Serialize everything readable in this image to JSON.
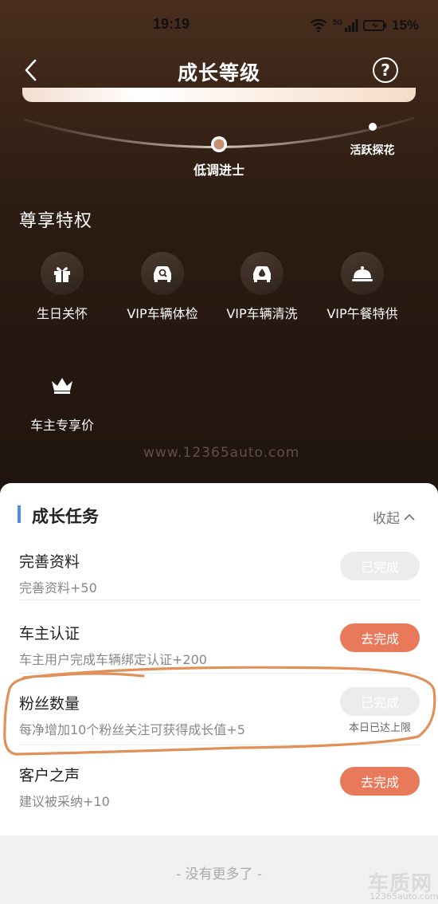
{
  "status_bar": {
    "time": "19:19",
    "network": "5G",
    "battery": "15%"
  },
  "nav": {
    "title": "成长等级"
  },
  "levels": {
    "current": "低调进士",
    "next": "活跃探花"
  },
  "perks": {
    "title": "尊享特权",
    "items": [
      {
        "label": "生日关怀",
        "icon": "gift-icon"
      },
      {
        "label": "VIP车辆体检",
        "icon": "car-inspection-icon"
      },
      {
        "label": "VIP车辆清洗",
        "icon": "car-wash-icon"
      },
      {
        "label": "VIP午餐特供",
        "icon": "food-cloche-icon"
      },
      {
        "label": "车主专享价",
        "icon": "crown-icon"
      }
    ]
  },
  "watermark": "www.12365auto.com",
  "tasks": {
    "title": "成长任务",
    "collapse_label": "收起",
    "items": [
      {
        "name": "完善资料",
        "desc": "完善资料+50",
        "button": "已完成",
        "status": "done",
        "note": ""
      },
      {
        "name": "车主认证",
        "desc": "车主用户完成车辆绑定认证+200",
        "button": "去完成",
        "status": "todo",
        "note": ""
      },
      {
        "name": "粉丝数量",
        "desc": "每净增加10个粉丝关注可获得成长值+5",
        "button": "已完成",
        "status": "done",
        "note": "本日已达上限"
      },
      {
        "name": "客户之声",
        "desc": "建议被采纳+10",
        "button": "去完成",
        "status": "todo",
        "note": ""
      }
    ],
    "footer": "- 没有更多了 -"
  },
  "logo": {
    "main": "车质网",
    "sub": "12365auto.com"
  },
  "colors": {
    "accent_orange": "#e8795a",
    "title_bar_blue": "#4f8fd9",
    "done_button": "#ececec",
    "highlight_ring": "#e0915a"
  }
}
